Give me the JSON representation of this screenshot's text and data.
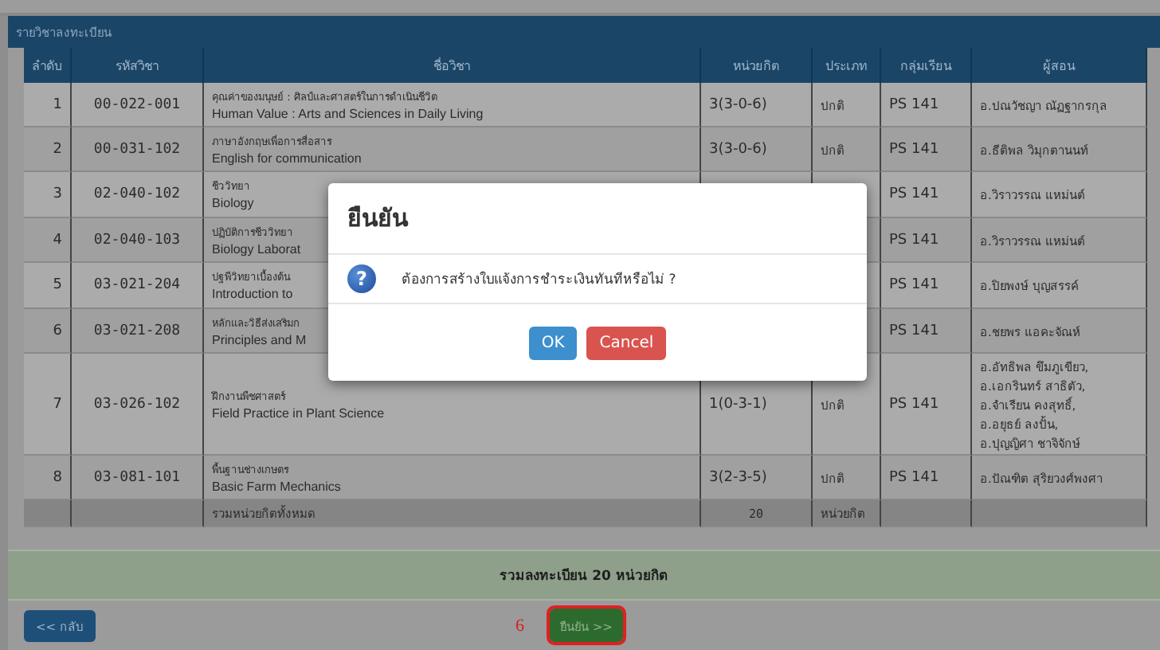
{
  "panel": {
    "title": "รายวิชาลงทะเบียน"
  },
  "table": {
    "columns": [
      "ลำดับ",
      "รหัสวิชา",
      "ชื่อวิชา",
      "หน่วยกิต",
      "ประเภท",
      "กลุ่มเรียน",
      "ผู้สอน"
    ],
    "rows": [
      {
        "no": "1",
        "code": "00-022-001",
        "name_th": "คุณค่าของมนุษย์ : ศิลป์และศาสตร์ในการดำเนินชีวิต",
        "name_en": "Human Value : Arts and Sciences in Daily Living",
        "credits": "3(3-0-6)",
        "type": "ปกติ",
        "group": "PS 141",
        "teachers": [
          "อ.ปณวัชญา ณัฏฐากรกุล"
        ]
      },
      {
        "no": "2",
        "code": "00-031-102",
        "name_th": "ภาษาอังกฤษเพื่อการสื่อสาร",
        "name_en": "English for communication",
        "credits": "3(3-0-6)",
        "type": "ปกติ",
        "group": "PS 141",
        "teachers": [
          "อ.ธีติพล วิมุกตานนท์"
        ]
      },
      {
        "no": "3",
        "code": "02-040-102",
        "name_th": "ชีววิทยา",
        "name_en": "Biology",
        "group": "PS 141",
        "teachers": [
          "อ.วิราวรรณ แหม่นต์"
        ]
      },
      {
        "no": "4",
        "code": "02-040-103",
        "name_th": "ปฏิบัติการชีววิทยา",
        "name_en": "Biology Laborat",
        "group": "PS 141",
        "teachers": [
          "อ.วิราวรรณ แหม่นต์"
        ]
      },
      {
        "no": "5",
        "code": "03-021-204",
        "name_th": "ปฐพีวิทยาเบื้องต้น",
        "name_en": "Introduction to",
        "group": "PS 141",
        "teachers": [
          "อ.ปิยพงษ์ บุญสรรค์"
        ]
      },
      {
        "no": "6",
        "code": "03-021-208",
        "name_th": "หลักและวิธีส่งเสริมก",
        "name_en": "Principles and M",
        "group": "PS 141",
        "teachers": [
          "อ.ชยพร แอคะจัณห์"
        ]
      },
      {
        "no": "7",
        "code": "03-026-102",
        "name_th": "ฝึกงานพืชศาสตร์",
        "name_en": "Field Practice in Plant Science",
        "credits": "1(0-3-1)",
        "type": "ปกติ",
        "group": "PS 141",
        "teachers": [
          "อ.อัทธิพล ขึมภูเขียว,",
          "อ.เอกรินทร์ สาธิตัว,",
          "อ.จำเรียน คงสุทธิ์,",
          "อ.อยุธย์ ลงปั้น,",
          "อ.ปุญญิศา ชาจิจักษ์"
        ]
      },
      {
        "no": "8",
        "code": "03-081-101",
        "name_th": "พื้นฐานช่างเกษตร",
        "name_en": "Basic Farm Mechanics",
        "credits": "3(2-3-5)",
        "type": "ปกติ",
        "group": "PS 141",
        "teachers": [
          "อ.ปัณฑิต สุริยวงศ์พงศา"
        ]
      }
    ],
    "total": {
      "label": "รวมหน่วยกิตทั้งหมด",
      "credits": "20",
      "unit": "หน่วยกิต"
    }
  },
  "summary": "รวมลงทะเบียน 20 หน่วยกิต",
  "footer": {
    "back_button": "<< กลับ",
    "annotation": "6",
    "confirm_button": {
      "label": "ยืนยัน >>",
      "highlighted": true
    }
  },
  "dialog": {
    "title": "ยืนยัน",
    "icon": "?",
    "message": "ต้องการสร้างใบแจ้งการชำระเงินทันทีหรือไม่ ?",
    "buttons": [
      {
        "label": "OK",
        "kind": "primary"
      },
      {
        "label": "Cancel",
        "kind": "danger"
      }
    ]
  }
}
